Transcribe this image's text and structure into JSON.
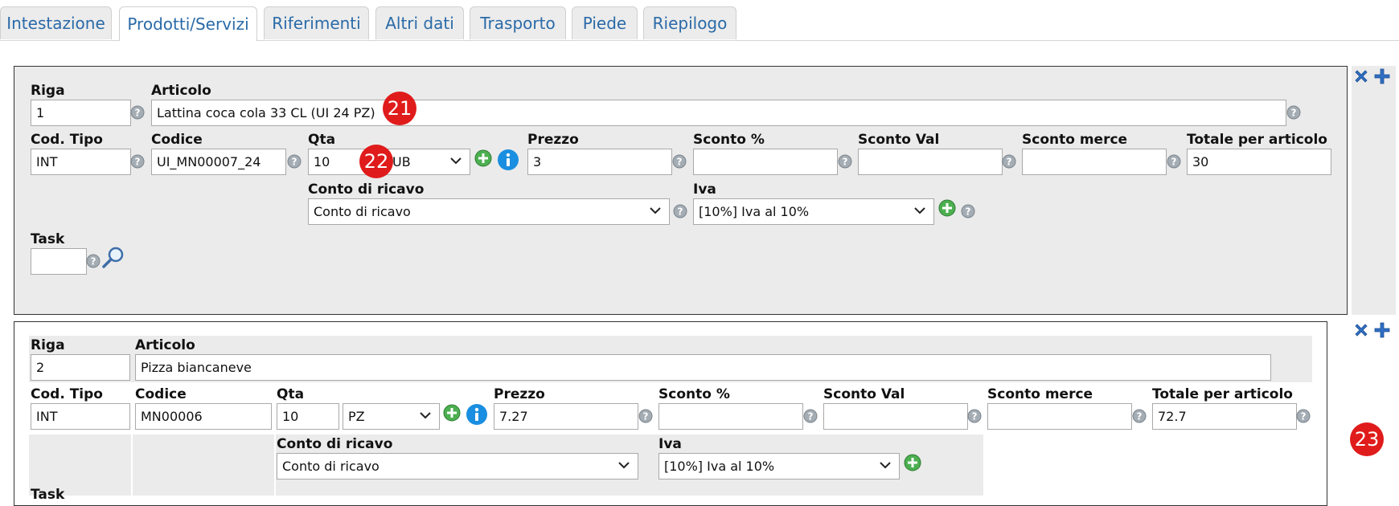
{
  "tabs": [
    "Intestazione",
    "Prodotti/Servizi",
    "Riferimenti",
    "Altri dati",
    "Trasporto",
    "Piede",
    "Riepilogo"
  ],
  "labels": {
    "riga": "Riga",
    "articolo": "Articolo",
    "cod_tipo": "Cod. Tipo",
    "codice": "Codice",
    "qta": "Qta",
    "prezzo": "Prezzo",
    "sconto_pct": "Sconto %",
    "sconto_val": "Sconto Val",
    "sconto_merce": "Sconto merce",
    "totale": "Totale per articolo",
    "conto": "Conto di ricavo",
    "iva": "Iva",
    "task": "Task"
  },
  "row1": {
    "riga": "1",
    "articolo": "Lattina coca cola 33 CL (UI 24 PZ)",
    "cod_tipo": "INT",
    "codice": "UI_MN00007_24",
    "qta": "10",
    "unit": "UB",
    "prezzo": "3",
    "sconto_pct": "",
    "sconto_val": "",
    "sconto_merce": "",
    "totale": "30",
    "conto": "Conto di ricavo",
    "iva": "[10%] Iva al 10%",
    "task": ""
  },
  "row2": {
    "riga": "2",
    "articolo": "Pizza biancaneve",
    "cod_tipo": "INT",
    "codice": "MN00006",
    "qta": "10",
    "unit": "PZ",
    "prezzo": "7.27",
    "sconto_pct": "",
    "sconto_val": "",
    "sconto_merce": "",
    "totale": "72.7",
    "conto": "Conto di ricavo",
    "iva": "[10%] Iva al 10%"
  },
  "badges": {
    "b21": "21",
    "b22": "22",
    "b23": "23"
  },
  "colors": {
    "tab_text": "#2a6aa8",
    "badge": "#e01b1b",
    "panel_bg": "#ebebeb",
    "plus_blue": "#2f6fc4"
  },
  "icons": [
    "help-icon",
    "add-green-icon",
    "info-icon",
    "search-magnifier-icon",
    "delete-row-icon",
    "add-row-icon"
  ]
}
